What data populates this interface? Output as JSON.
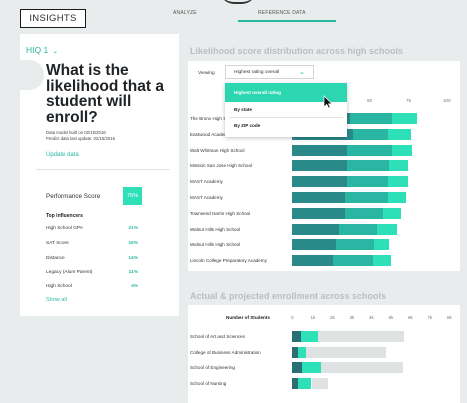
{
  "header": {
    "brand": "INSIGHTS",
    "tabs": [
      {
        "label": "ANALYZE"
      },
      {
        "label": "REFERENCE DATA"
      }
    ]
  },
  "sidebar": {
    "hiq_label": "HIQ 1",
    "question": "What is the likelihood that a student will enroll?",
    "meta_built": "Data model built on 02/15/2016",
    "meta_update": "Predict data last update: 02/15/2016",
    "update_link": "Update data",
    "performance_label": "Performance Score",
    "performance_value": "76%",
    "top_influencers_label": "Top influencers",
    "influencers": [
      {
        "name": "High School GPA",
        "value": "21%"
      },
      {
        "name": "SAT Score",
        "value": "16%"
      },
      {
        "name": "Distance",
        "value": "14%"
      },
      {
        "name": "Legacy (Alum Parent)",
        "value": "11%"
      },
      {
        "name": "High School",
        "value": "4%"
      }
    ],
    "show_all": "Show all"
  },
  "chart1": {
    "title": "Likelihood score distribution across high schools",
    "viewing_label": "Viewing",
    "select_value": "Highest rating overall",
    "dropdown_options": [
      "Highest overall rating",
      "By state",
      "By ZIP code"
    ],
    "tick_labels": [
      "50",
      "75",
      "100"
    ]
  },
  "chart2": {
    "title": "Actual & projected enrollment across schools",
    "column_label": "Number of Students",
    "tick_labels": [
      "0",
      "1k",
      "2k",
      "3k",
      "4k",
      "5k",
      "6k",
      "7k",
      "8k"
    ]
  },
  "colors": {
    "accent": "#25b8a1",
    "dark_teal": "#2a8a8a",
    "mid_teal": "#2bb5a3",
    "bright_green": "#2ee0b8",
    "gray_bar": "#dfe2e2"
  },
  "chart_data": [
    {
      "type": "bar",
      "orientation": "horizontal-stacked",
      "title": "Likelihood score distribution across high schools",
      "categories": [
        "The Bronx High School",
        "Eastwood Academy",
        "Walt Whitman High School",
        "Mission San Jose High School",
        "MAST Academy",
        "MAST Academy",
        "Townsend Harris High School",
        "Walnut Hills High School",
        "Walnut Hills High School",
        "Lincoln College Preparatory Academy"
      ],
      "series": [
        {
          "values": [
            38,
            40,
            36,
            36,
            36,
            35,
            35,
            31,
            29,
            27
          ]
        },
        {
          "values": [
            28,
            23,
            30,
            28,
            27,
            28,
            25,
            25,
            25,
            26
          ]
        },
        {
          "values": [
            16,
            15,
            13,
            12,
            13,
            12,
            12,
            13,
            10,
            12
          ]
        }
      ],
      "xlim": [
        0,
        100
      ],
      "xticks": [
        50,
        75,
        100
      ]
    },
    {
      "type": "bar",
      "orientation": "horizontal-stacked",
      "title": "Actual & projected enrollment across schools",
      "categories": [
        "School of Art and Sciences",
        "College of Business Administration",
        "School of Engineering",
        "School of Nursing"
      ],
      "series": [
        {
          "values": [
            0.45,
            0.3,
            0.5,
            0.3
          ]
        },
        {
          "values": [
            0.9,
            0.4,
            1.0,
            0.7
          ]
        },
        {
          "values": [
            4.4,
            4.1,
            4.2,
            0.85
          ]
        }
      ],
      "xlim": [
        0,
        8
      ],
      "xlabel": "Number of Students"
    }
  ]
}
